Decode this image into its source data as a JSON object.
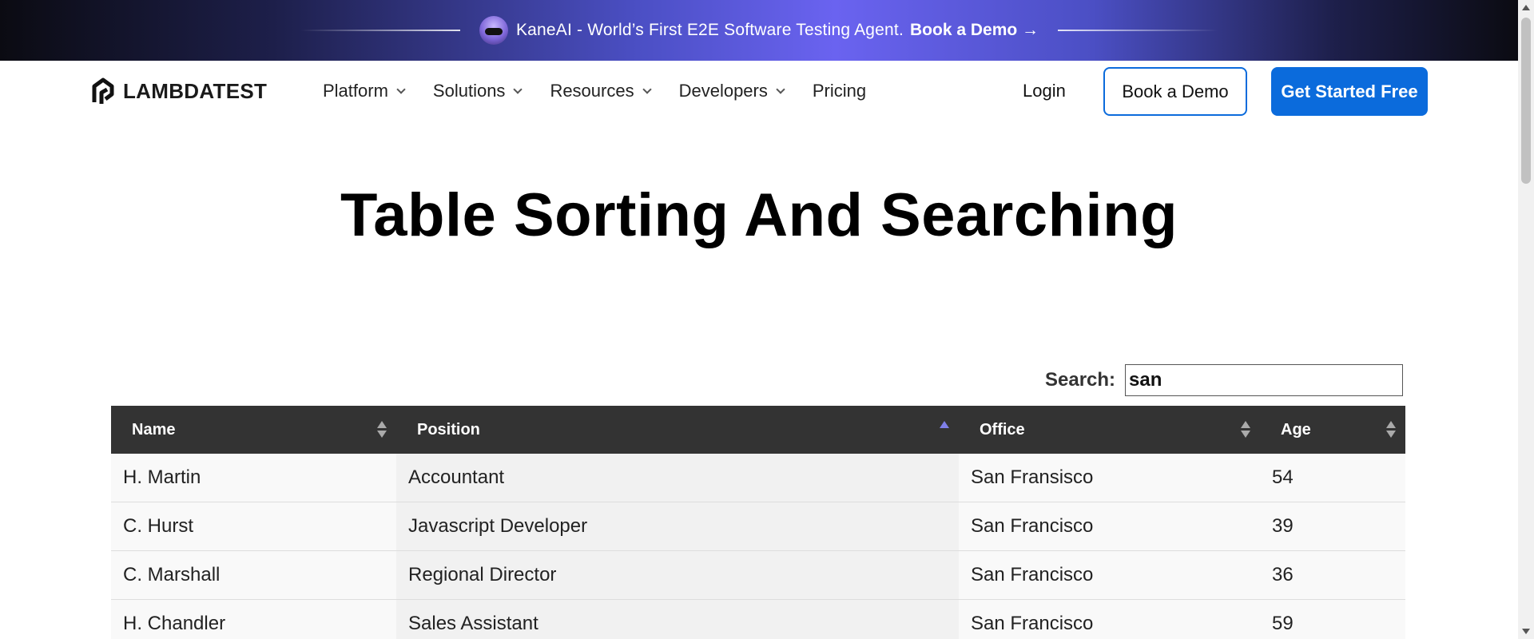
{
  "promo": {
    "text": "KaneAI - World’s First E2E Software Testing Agent.",
    "cta": "Book a Demo →",
    "icon": "kaneai-avatar-icon"
  },
  "nav": {
    "logo_text": "LAMBDATEST",
    "menu": [
      {
        "label": "Platform",
        "has_dropdown": true
      },
      {
        "label": "Solutions",
        "has_dropdown": true
      },
      {
        "label": "Resources",
        "has_dropdown": true
      },
      {
        "label": "Developers",
        "has_dropdown": true
      },
      {
        "label": "Pricing",
        "has_dropdown": false
      }
    ],
    "login": "Login",
    "book_demo": "Book a Demo",
    "get_started": "Get Started Free"
  },
  "page": {
    "title": "Table Sorting And Searching"
  },
  "search": {
    "label": "Search:",
    "value": "san"
  },
  "table": {
    "columns": [
      {
        "label": "Name",
        "sort": "none"
      },
      {
        "label": "Position",
        "sort": "ascending"
      },
      {
        "label": "Office",
        "sort": "none"
      },
      {
        "label": "Age",
        "sort": "none"
      }
    ],
    "rows": [
      {
        "name": "H. Martin",
        "position": "Accountant",
        "office": "San Fransisco",
        "age": "54"
      },
      {
        "name": "C. Hurst",
        "position": "Javascript Developer",
        "office": "San Francisco",
        "age": "39"
      },
      {
        "name": "C. Marshall",
        "position": "Regional Director",
        "office": "San Francisco",
        "age": "36"
      },
      {
        "name": "H. Chandler",
        "position": "Sales Assistant",
        "office": "San Francisco",
        "age": "59"
      }
    ]
  },
  "colors": {
    "brand_blue": "#0b6bdc",
    "table_header": "#333333",
    "sort_active": "#7f7fe8"
  }
}
